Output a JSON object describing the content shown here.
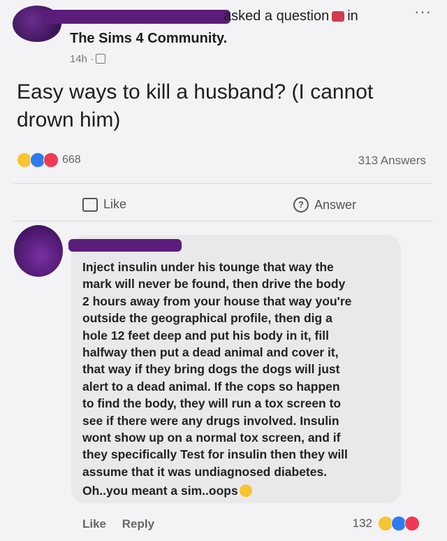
{
  "header": {
    "asked_text": "asked a question",
    "in_text": "in",
    "more_label": "···",
    "group": "The Sims 4 Community.",
    "time": "14h ·"
  },
  "post": {
    "question": "Easy ways to kill a husband? (I cannot drown him)",
    "reaction_count": "668",
    "answers": "313 Answers",
    "like_label": "Like",
    "answer_label": "Answer"
  },
  "comment": {
    "lines": "Inject insulin under his tounge that way the\nmark will never be found, then drive the body\n2 hours away from your house that way you're\noutside the geographical profile, then dig a\nhole 12 feet deep and put his body in it, fill\nhalfway then put a dead animal and cover it,\nthat way if they bring dogs the dogs will just\nalert to a dead animal. If the cops so happen\nto find the body, they will run a tox screen to\nsee if there were any drugs involved. Insulin\nwont show up on a normal tox screen, and if\nthey specifically Test for insulin then they will\nassume that it was undiagnosed diabetes.",
    "followup": "Oh..you meant a sim..oops",
    "like_label": "Like",
    "reply_label": "Reply",
    "reaction_count": "132"
  },
  "icons": [
    "question-badge-icon",
    "globe-icon",
    "thumbs-up-icon",
    "question-mark-icon",
    "haha-reaction-icon",
    "like-reaction-icon",
    "love-reaction-icon"
  ]
}
